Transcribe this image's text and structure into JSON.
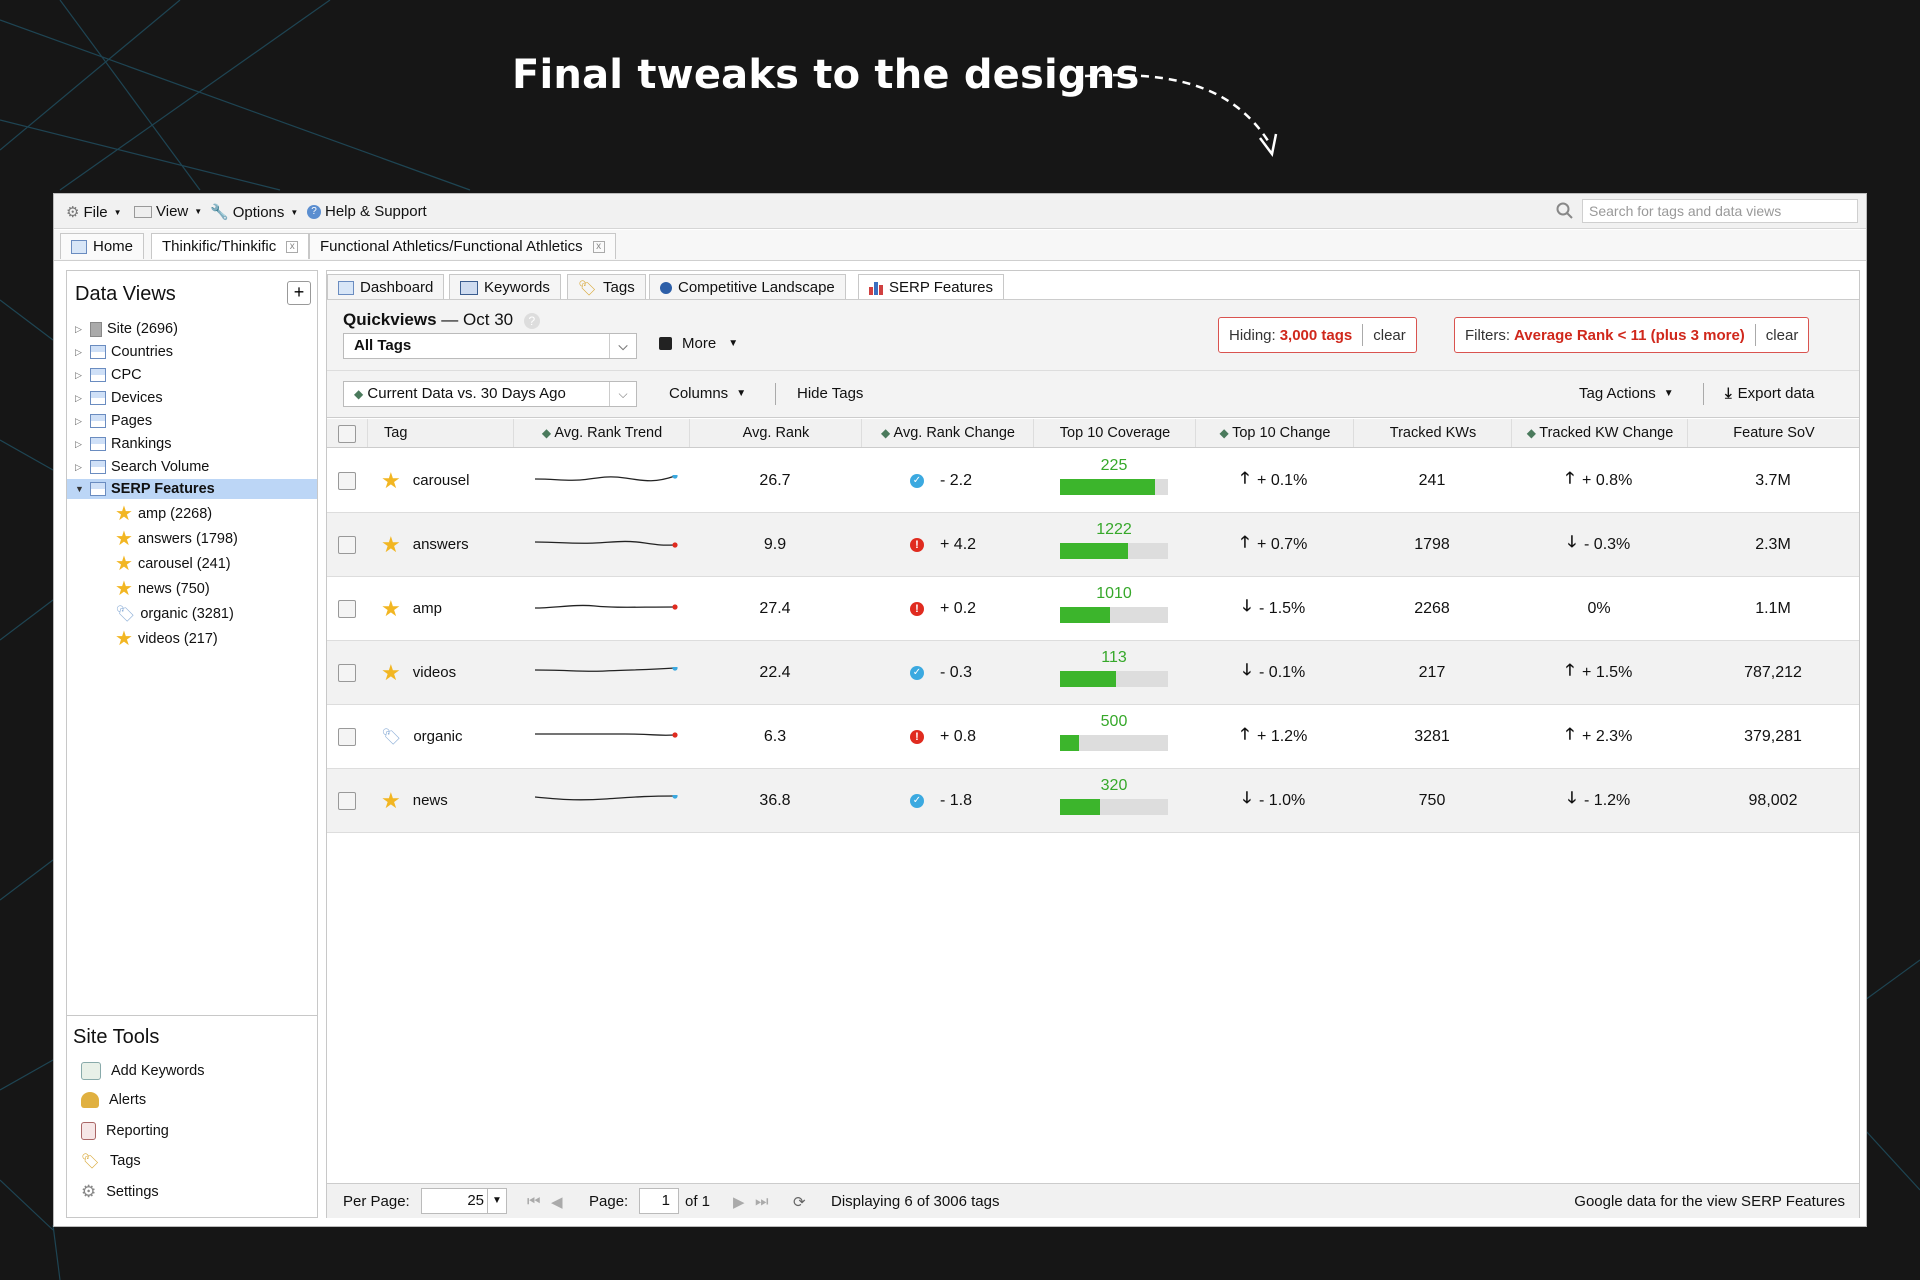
{
  "headline": "Final tweaks to the designs",
  "menubar": {
    "file": "File",
    "view": "View",
    "options": "Options",
    "help": "Help & Support",
    "search_placeholder": "Search for tags and data views"
  },
  "window_tabs": [
    "Home",
    "Thinkific/Thinkific",
    "Functional Athletics/Functional Athletics"
  ],
  "sidebar": {
    "title": "Data Views",
    "add_label": "+",
    "tree": [
      {
        "label": "Site (2696)"
      },
      {
        "label": "Countries"
      },
      {
        "label": "CPC"
      },
      {
        "label": "Devices"
      },
      {
        "label": "Pages"
      },
      {
        "label": "Rankings"
      },
      {
        "label": "Search Volume"
      },
      {
        "label": "SERP Features"
      }
    ],
    "serp_children": [
      {
        "label": "amp (2268)",
        "icon": "star-icon"
      },
      {
        "label": "answers (1798)",
        "icon": "star-icon"
      },
      {
        "label": "carousel (241)",
        "icon": "star-icon"
      },
      {
        "label": "news (750)",
        "icon": "star-icon"
      },
      {
        "label": "organic (3281)",
        "icon": "tag-icon"
      },
      {
        "label": "videos (217)",
        "icon": "star-icon"
      }
    ],
    "site_tools_title": "Site Tools",
    "site_tools": [
      "Add Keywords",
      "Alerts",
      "Reporting",
      "Tags",
      "Settings"
    ]
  },
  "subtabs": [
    "Dashboard",
    "Keywords",
    "Tags",
    "Competitive Landscape",
    "SERP Features"
  ],
  "quickviews": {
    "title": "Quickviews",
    "date": "— Oct 30",
    "selected": "All Tags",
    "more": "More",
    "hiding_label": "Hiding:",
    "hiding_value": "3,000 tags",
    "clear": "clear",
    "filters_label": "Filters:",
    "filters_value": "Average Rank < 11 (plus 3 more)"
  },
  "toolbar": {
    "compare": "Current Data vs. 30 Days Ago",
    "columns": "Columns",
    "hide_tags": "Hide Tags",
    "tag_actions": "Tag Actions",
    "export": "Export data"
  },
  "table": {
    "columns": [
      "Tag",
      "Avg. Rank Trend",
      "Avg. Rank",
      "Avg. Rank Change",
      "Top 10 Coverage",
      "Top 10 Change",
      "Tracked KWs",
      "Tracked KW Change",
      "Feature SoV"
    ],
    "rows": [
      {
        "tag": "carousel",
        "icon": "star-icon",
        "avg_rank": "26.7",
        "rank_status": "good",
        "rank_change": "- 2.2",
        "coverage": "225",
        "coverage_fill": 0.88,
        "t10_dir": "up",
        "t10_change": "+ 0.1%",
        "tracked": "241",
        "kw_dir": "up",
        "kw_change": "+ 0.8%",
        "sov": "3.7M",
        "trend_end": "blue"
      },
      {
        "tag": "answers",
        "icon": "star-icon",
        "avg_rank": "9.9",
        "rank_status": "bad",
        "rank_change": "+ 4.2",
        "coverage": "1222",
        "coverage_fill": 0.63,
        "t10_dir": "up",
        "t10_change": "+ 0.7%",
        "tracked": "1798",
        "kw_dir": "down",
        "kw_change": "- 0.3%",
        "sov": "2.3M",
        "trend_end": "red"
      },
      {
        "tag": "amp",
        "icon": "star-icon",
        "avg_rank": "27.4",
        "rank_status": "bad",
        "rank_change": "+ 0.2",
        "coverage": "1010",
        "coverage_fill": 0.46,
        "t10_dir": "down",
        "t10_change": "- 1.5%",
        "tracked": "2268",
        "kw_dir": "none",
        "kw_change": "0%",
        "sov": "1.1M",
        "trend_end": "red"
      },
      {
        "tag": "videos",
        "icon": "star-icon",
        "avg_rank": "22.4",
        "rank_status": "good",
        "rank_change": "- 0.3",
        "coverage": "113",
        "coverage_fill": 0.52,
        "t10_dir": "down",
        "t10_change": "- 0.1%",
        "tracked": "217",
        "kw_dir": "up",
        "kw_change": "+ 1.5%",
        "sov": "787,212",
        "trend_end": "blue"
      },
      {
        "tag": "organic",
        "icon": "tag-icon",
        "avg_rank": "6.3",
        "rank_status": "bad",
        "rank_change": "+ 0.8",
        "coverage": "500",
        "coverage_fill": 0.18,
        "t10_dir": "up",
        "t10_change": "+ 1.2%",
        "tracked": "3281",
        "kw_dir": "up",
        "kw_change": "+ 2.3%",
        "sov": "379,281",
        "trend_end": "red"
      },
      {
        "tag": "news",
        "icon": "star-icon",
        "avg_rank": "36.8",
        "rank_status": "good",
        "rank_change": "- 1.8",
        "coverage": "320",
        "coverage_fill": 0.37,
        "t10_dir": "down",
        "t10_change": "- 1.0%",
        "tracked": "750",
        "kw_dir": "down",
        "kw_change": "- 1.2%",
        "sov": "98,002",
        "trend_end": "blue"
      }
    ]
  },
  "footer": {
    "per_page_label": "Per Page:",
    "per_page": "25",
    "page_label": "Page:",
    "page": "1",
    "of": "of 1",
    "displaying": "Displaying 6 of 3006 tags",
    "source": "Google data for the view SERP Features"
  },
  "colors": {
    "accent_green": "#3cb52c",
    "alert_red": "#d0281c",
    "ok_blue": "#3ba9e0",
    "selected_bg": "#bcd6f6"
  }
}
